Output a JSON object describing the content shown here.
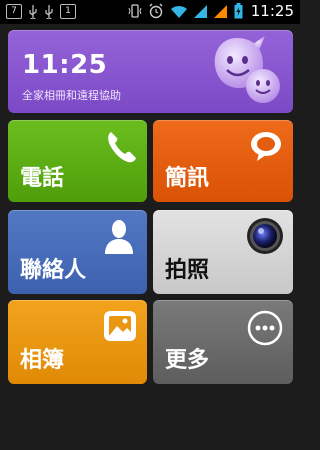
{
  "status_bar": {
    "left_icons": [
      "notification-7-icon",
      "usb-icon",
      "usb-icon",
      "notification-1-icon"
    ],
    "notif_left": "7",
    "notif_right": "1",
    "right_icons": [
      "vibrate-icon",
      "alarm-icon",
      "wifi-icon",
      "signal-icon",
      "signal-icon",
      "battery-charging-icon"
    ],
    "time": "11:25"
  },
  "clock_tile": {
    "time": "11:25",
    "subtitle": "全家相冊和遠程協助",
    "icon": "smiley-faces-icon",
    "color": "#8a55d0"
  },
  "tiles": [
    {
      "label": "電話",
      "icon": "phone-icon",
      "color": "#5ea612"
    },
    {
      "label": "簡訊",
      "icon": "message-bubble-icon",
      "color": "#e35d0e"
    },
    {
      "label": "聯絡人",
      "icon": "person-icon",
      "color": "#4a6dba"
    },
    {
      "label": "拍照",
      "icon": "camera-lens-icon",
      "color": "#d5d5d5"
    },
    {
      "label": "相簿",
      "icon": "picture-icon",
      "color": "#eb9612"
    },
    {
      "label": "更多",
      "icon": "more-dots-icon",
      "color": "#6b6b6b"
    }
  ]
}
